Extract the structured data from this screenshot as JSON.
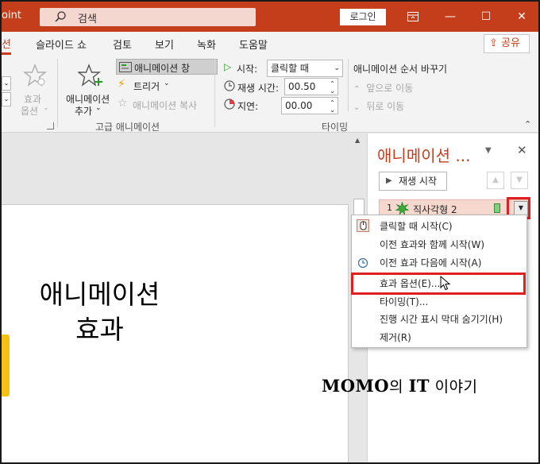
{
  "titlebar": {
    "app_name_fragment": "oint",
    "search_placeholder": "검색",
    "login_label": "로그인",
    "ribbon_display_icon": "ribbon-display-icon",
    "minimize": "—",
    "maximize": "☐",
    "close": "✕",
    "accent_color": "#c43e1c"
  },
  "tabs": {
    "active_fragment": "션",
    "items": [
      "슬라이드 쇼",
      "검토",
      "보기",
      "녹화",
      "도움말"
    ],
    "share_label": "공유"
  },
  "ribbon": {
    "effect_options": {
      "label_line1": "효과",
      "label_line2": "옵션"
    },
    "add_animation": {
      "label_line1": "애니메이션",
      "label_line2": "추가"
    },
    "animation_pane": "애니메이션 창",
    "trigger": "트리거",
    "animation_painter": "애니메이션 복사",
    "advanced_group_label": "고급 애니메이션",
    "start_label": "시작:",
    "start_value": "클릭할 때",
    "duration_label": "재생 시간:",
    "duration_value": "00.50",
    "delay_label": "지연:",
    "delay_value": "00.00",
    "reorder_title": "애니메이션 순서 바꾸기",
    "move_earlier": "앞으로 이동",
    "move_later": "뒤로 이동",
    "timing_group_label": "타이밍"
  },
  "slide": {
    "title_line1": "애니메이션",
    "title_line2": "효과"
  },
  "pane": {
    "title": "애니메이션 ...",
    "play_label": "재생 시작",
    "item_number": "1",
    "item_label": "직사각형 2"
  },
  "context_menu": {
    "items": [
      "클릭할 때 시작(C)",
      "이전 효과와 함께 시작(W)",
      "이전 효과 다음에 시작(A)",
      "효과 옵션(E)...",
      "타이밍(T)...",
      "진행 시간 표시 막대 숨기기(H)",
      "제거(R)"
    ]
  },
  "watermark": {
    "brand": "MOMO",
    "part2": "의 ",
    "brand2": "IT",
    "part3": " 이야기"
  }
}
